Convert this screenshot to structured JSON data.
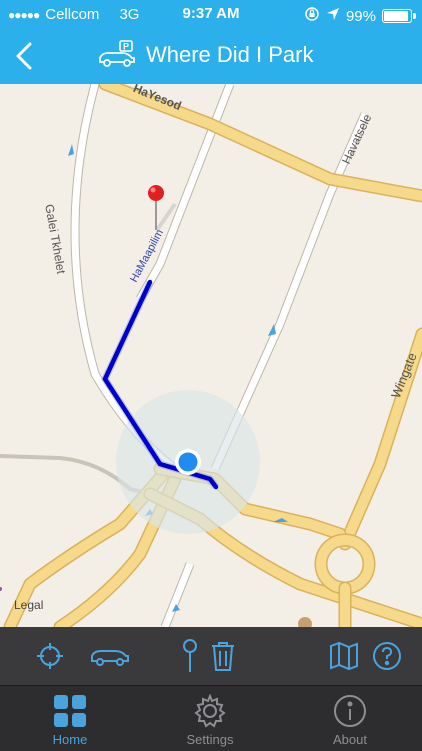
{
  "status": {
    "carrier": "Cellcom",
    "network": "3G",
    "time": "9:37 AM",
    "battery": "99%",
    "battery_level": 0.99
  },
  "nav": {
    "title": "Where Did I Park"
  },
  "map": {
    "streets": {
      "hamesilla": "HaYesod",
      "havatselet": "Havatsele",
      "galei": "Galei Tkhelet",
      "hamaapilim": "HaMaapilim",
      "wingate": "Wingate",
      "legal": "Legal"
    }
  },
  "toolbar": {
    "icons": [
      "crosshair-icon",
      "car-icon",
      "pin-icon",
      "trash-icon",
      "map-icon",
      "help-icon"
    ]
  },
  "tabs": [
    {
      "label": "Home",
      "icon": "home-grid-icon",
      "active": true
    },
    {
      "label": "Settings",
      "icon": "gear-icon",
      "active": false
    },
    {
      "label": "About",
      "icon": "info-icon",
      "active": false
    }
  ],
  "colors": {
    "accent": "#2bb0ec",
    "route": "#0000cc",
    "road": "#f6d98a",
    "map_bg": "#f4efe6",
    "toolbar_icon": "#4aa3dd"
  }
}
